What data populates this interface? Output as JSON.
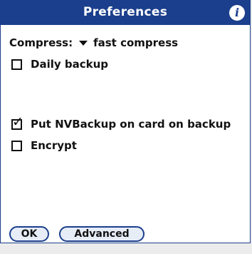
{
  "title": "Preferences",
  "info_icon_glyph": "i",
  "compress": {
    "label": "Compress:",
    "value": "fast compress"
  },
  "options": {
    "daily_backup": {
      "label": "Daily backup",
      "checked": false
    },
    "put_on_card": {
      "label": "Put NVBackup on card on backup",
      "checked": true,
      "check_glyph": "✓"
    },
    "encrypt": {
      "label": "Encrypt",
      "checked": false
    }
  },
  "buttons": {
    "ok": "OK",
    "advanced": "Advanced"
  },
  "colors": {
    "accent": "#1b3f8c",
    "background": "#ffffff"
  }
}
